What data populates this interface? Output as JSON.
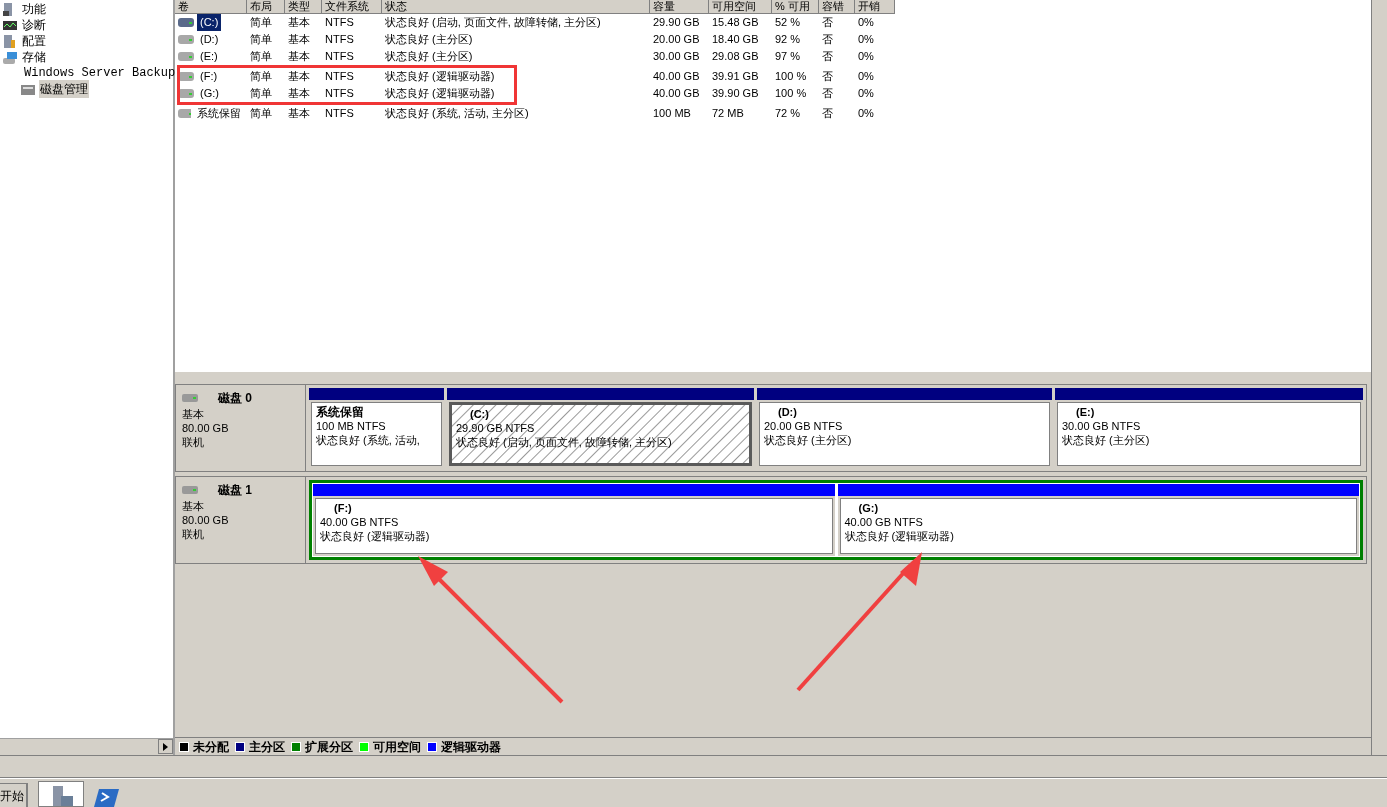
{
  "tree": {
    "items": [
      {
        "label": "功能",
        "selected": false
      },
      {
        "label": "诊断",
        "selected": false
      },
      {
        "label": "配置",
        "selected": false
      },
      {
        "label": "存储",
        "selected": false,
        "children": [
          {
            "label": "Windows Server Backup",
            "selected": false
          },
          {
            "label": "磁盘管理",
            "selected": true
          }
        ]
      }
    ]
  },
  "volume_table": {
    "columns": [
      "卷",
      "布局",
      "类型",
      "文件系统",
      "状态",
      "容量",
      "可用空间",
      "% 可用",
      "容错",
      "开销"
    ],
    "rows": [
      {
        "selected": true,
        "cells": [
          "(C:)",
          "简单",
          "基本",
          "NTFS",
          "状态良好 (启动, 页面文件, 故障转储, 主分区)",
          "29.90 GB",
          "15.48 GB",
          "52 %",
          "否",
          "0%"
        ]
      },
      {
        "selected": false,
        "cells": [
          "(D:)",
          "简单",
          "基本",
          "NTFS",
          "状态良好 (主分区)",
          "20.00 GB",
          "18.40 GB",
          "92 %",
          "否",
          "0%"
        ]
      },
      {
        "selected": false,
        "cells": [
          "(E:)",
          "简单",
          "基本",
          "NTFS",
          "状态良好 (主分区)",
          "30.00 GB",
          "29.08 GB",
          "97 %",
          "否",
          "0%"
        ]
      },
      {
        "selected": false,
        "cells": [
          "(F:)",
          "简单",
          "基本",
          "NTFS",
          "状态良好 (逻辑驱动器)",
          "40.00 GB",
          "39.91 GB",
          "100 %",
          "否",
          "0%"
        ]
      },
      {
        "selected": false,
        "cells": [
          "(G:)",
          "简单",
          "基本",
          "NTFS",
          "状态良好 (逻辑驱动器)",
          "40.00 GB",
          "39.90 GB",
          "100 %",
          "否",
          "0%"
        ]
      },
      {
        "selected": false,
        "cells": [
          "系统保留",
          "简单",
          "基本",
          "NTFS",
          "状态良好 (系统, 活动, 主分区)",
          "100 MB",
          "72 MB",
          "72 %",
          "否",
          "0%"
        ]
      }
    ]
  },
  "disks": [
    {
      "name": "磁盘 0",
      "type": "基本",
      "size": "80.00 GB",
      "status": "联机",
      "extended": false,
      "partitions": [
        {
          "kind": "primary",
          "selected": false,
          "name": "系统保留",
          "size": "100 MB NTFS",
          "status": "状态良好 (系统, 活动,"
        },
        {
          "kind": "primary",
          "selected": true,
          "name": "(C:)",
          "size": "29.90 GB NTFS",
          "status": "状态良好 (启动, 页面文件, 故障转储, 主分区)"
        },
        {
          "kind": "primary",
          "selected": false,
          "name": "(D:)",
          "size": "20.00 GB NTFS",
          "status": "状态良好 (主分区)"
        },
        {
          "kind": "primary",
          "selected": false,
          "name": "(E:)",
          "size": "30.00 GB NTFS",
          "status": "状态良好 (主分区)"
        }
      ]
    },
    {
      "name": "磁盘 1",
      "type": "基本",
      "size": "80.00 GB",
      "status": "联机",
      "extended": true,
      "partitions": [
        {
          "kind": "logical",
          "selected": false,
          "name": "(F:)",
          "size": "40.00 GB NTFS",
          "status": "状态良好 (逻辑驱动器)"
        },
        {
          "kind": "logical",
          "selected": false,
          "name": "(G:)",
          "size": "40.00 GB NTFS",
          "status": "状态良好 (逻辑驱动器)"
        }
      ]
    }
  ],
  "legend": [
    {
      "label": "未分配",
      "color": "#000000"
    },
    {
      "label": "主分区",
      "color": "#000080"
    },
    {
      "label": "扩展分区",
      "color": "#008000"
    },
    {
      "label": "可用空间",
      "color": "#00ff00"
    },
    {
      "label": "逻辑驱动器",
      "color": "#0000ff"
    }
  ],
  "taskbar": {
    "start_label": "开始"
  }
}
